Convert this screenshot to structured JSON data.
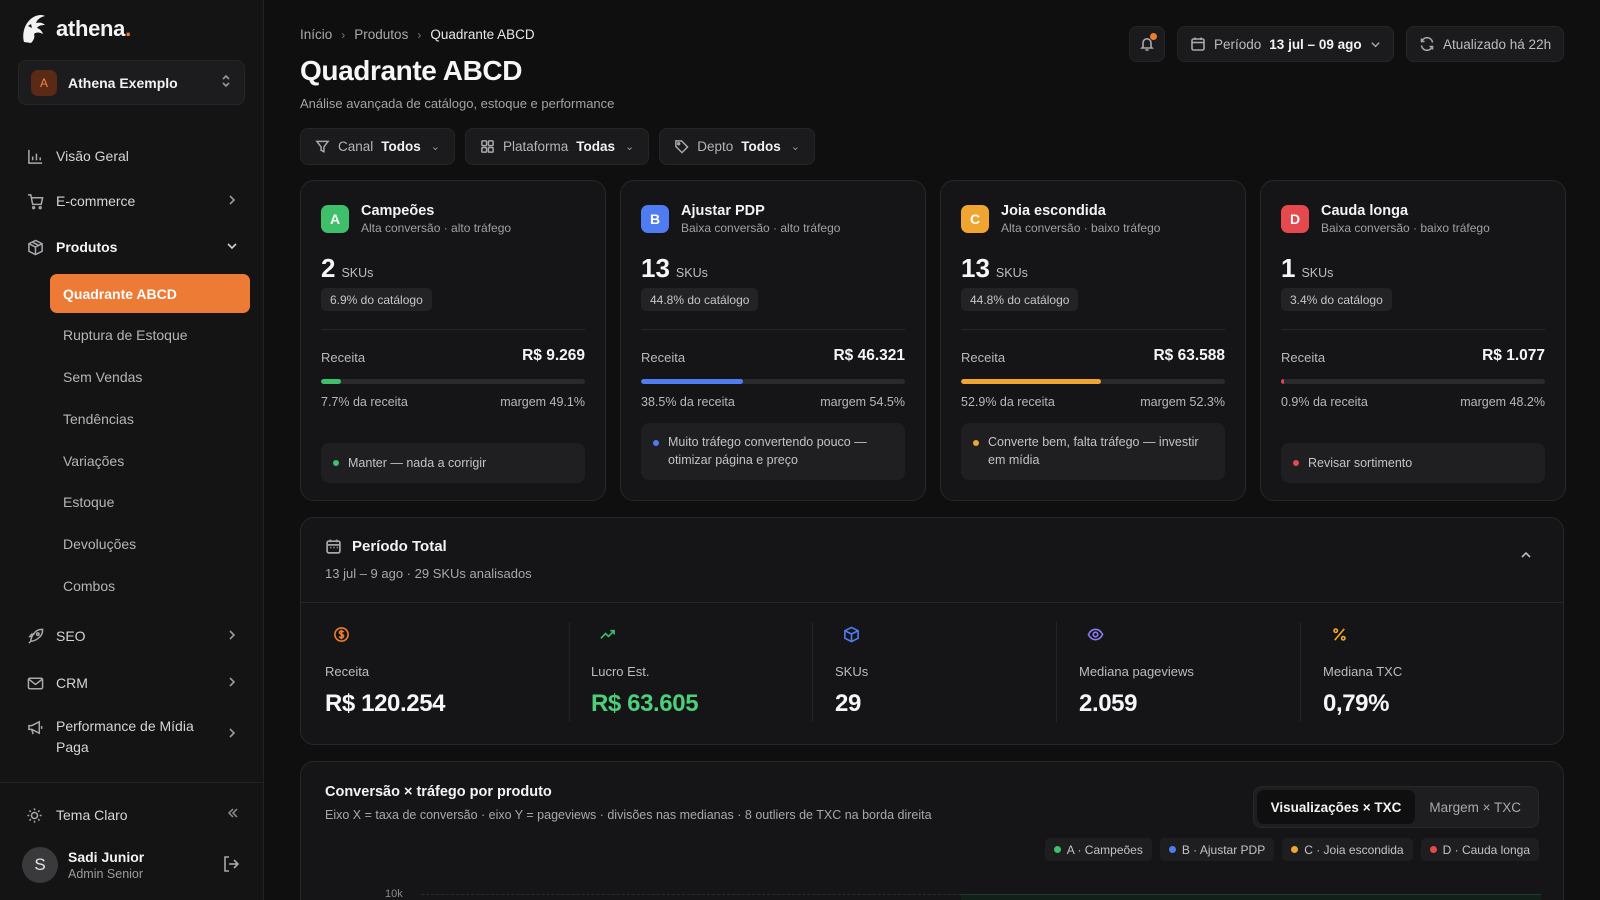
{
  "brand": {
    "name": "athena",
    "dot": "."
  },
  "workspace": {
    "initial": "A",
    "name": "Athena Exemplo"
  },
  "nav": {
    "visao_geral": "Visão Geral",
    "ecommerce": "E-commerce",
    "produtos": "Produtos",
    "sub": {
      "quadrante": "Quadrante ABCD",
      "ruptura": "Ruptura de Estoque",
      "sem_vendas": "Sem Vendas",
      "tendencias": "Tendências",
      "variacoes": "Variações",
      "estoque": "Estoque",
      "devolucoes": "Devoluções",
      "combos": "Combos"
    },
    "seo": "SEO",
    "crm": "CRM",
    "midia_l1": "Performance de Mídia",
    "midia_l2": "Paga"
  },
  "theme": {
    "label": "Tema Claro"
  },
  "user": {
    "initial": "S",
    "name": "Sadi Junior",
    "role": "Admin Senior"
  },
  "breadcrumb": {
    "home": "Início",
    "section": "Produtos",
    "current": "Quadrante ABCD"
  },
  "page": {
    "title": "Quadrante ABCD",
    "subtitle": "Análise avançada de catálogo, estoque e performance"
  },
  "header": {
    "periodo_label": "Período",
    "periodo_value": "13 jul – 09 ago",
    "updated": "Atualizado há 22h"
  },
  "filters": {
    "canal": {
      "label": "Canal",
      "value": "Todos"
    },
    "plataforma": {
      "label": "Plataforma",
      "value": "Todas"
    },
    "depto": {
      "label": "Depto",
      "value": "Todos"
    }
  },
  "quadrants": [
    {
      "letter": "A",
      "title": "Campeões",
      "desc": "Alta conversão · alto tráfego",
      "count": "2",
      "unit": "SKUs",
      "catalog": "6.9% do catálogo",
      "rev_label": "Receita",
      "revenue": "R$ 9.269",
      "rev_share": 7.7,
      "rev_pct": "7.7% da receita",
      "margin": "margem 49.1%",
      "note": "Manter — nada a corrigir",
      "color": "#3fbf6a"
    },
    {
      "letter": "B",
      "title": "Ajustar PDP",
      "desc": "Baixa conversão · alto tráfego",
      "count": "13",
      "unit": "SKUs",
      "catalog": "44.8% do catálogo",
      "rev_label": "Receita",
      "revenue": "R$ 46.321",
      "rev_share": 38.5,
      "rev_pct": "38.5% da receita",
      "margin": "margem 54.5%",
      "note": "Muito tráfego convertendo pouco — otimizar página e preço",
      "color": "#4f7cf0"
    },
    {
      "letter": "C",
      "title": "Joia escondida",
      "desc": "Alta conversão · baixo tráfego",
      "count": "13",
      "unit": "SKUs",
      "catalog": "44.8% do catálogo",
      "rev_label": "Receita",
      "revenue": "R$ 63.588",
      "rev_share": 52.9,
      "rev_pct": "52.9% da receita",
      "margin": "margem 52.3%",
      "note": "Converte bem, falta tráfego — investir em mídia",
      "color": "#f0a531"
    },
    {
      "letter": "D",
      "title": "Cauda longa",
      "desc": "Baixa conversão · baixo tráfego",
      "count": "1",
      "unit": "SKUs",
      "catalog": "3.4% do catálogo",
      "rev_label": "Receita",
      "revenue": "R$ 1.077",
      "rev_share": 0.9,
      "rev_pct": "0.9% da receita",
      "margin": "margem 48.2%",
      "note": "Revisar sortimento",
      "color": "#e5484d"
    }
  ],
  "period": {
    "title": "Período Total",
    "subtitle": "13 jul – 9 ago · 29 SKUs analisados",
    "metrics": {
      "receita": {
        "label": "Receita",
        "value": "R$ 120.254"
      },
      "lucro": {
        "label": "Lucro Est.",
        "value": "R$ 63.605"
      },
      "skus": {
        "label": "SKUs",
        "value": "29"
      },
      "pageviews": {
        "label": "Mediana pageviews",
        "value": "2.059"
      },
      "txc": {
        "label": "Mediana TXC",
        "value": "0,79%"
      }
    }
  },
  "scatter": {
    "title": "Conversão × tráfego por produto",
    "subtitle": "Eixo X = taxa de conversão · eixo Y = pageviews · divisões nas medianas · 8 outliers de TXC na borda direita",
    "tab_active": "Visualizações × TXC",
    "tab_other": "Margem × TXC",
    "legend": [
      "A · Campeões",
      "B · Ajustar PDP",
      "C · Joia escondida",
      "D · Cauda longa"
    ],
    "y_tick": "10k"
  },
  "colors": {
    "accent": "#ed7a35",
    "green": "#3fbf6a",
    "blue": "#4f7cf0",
    "amber": "#f0a531",
    "red": "#e5484d"
  }
}
